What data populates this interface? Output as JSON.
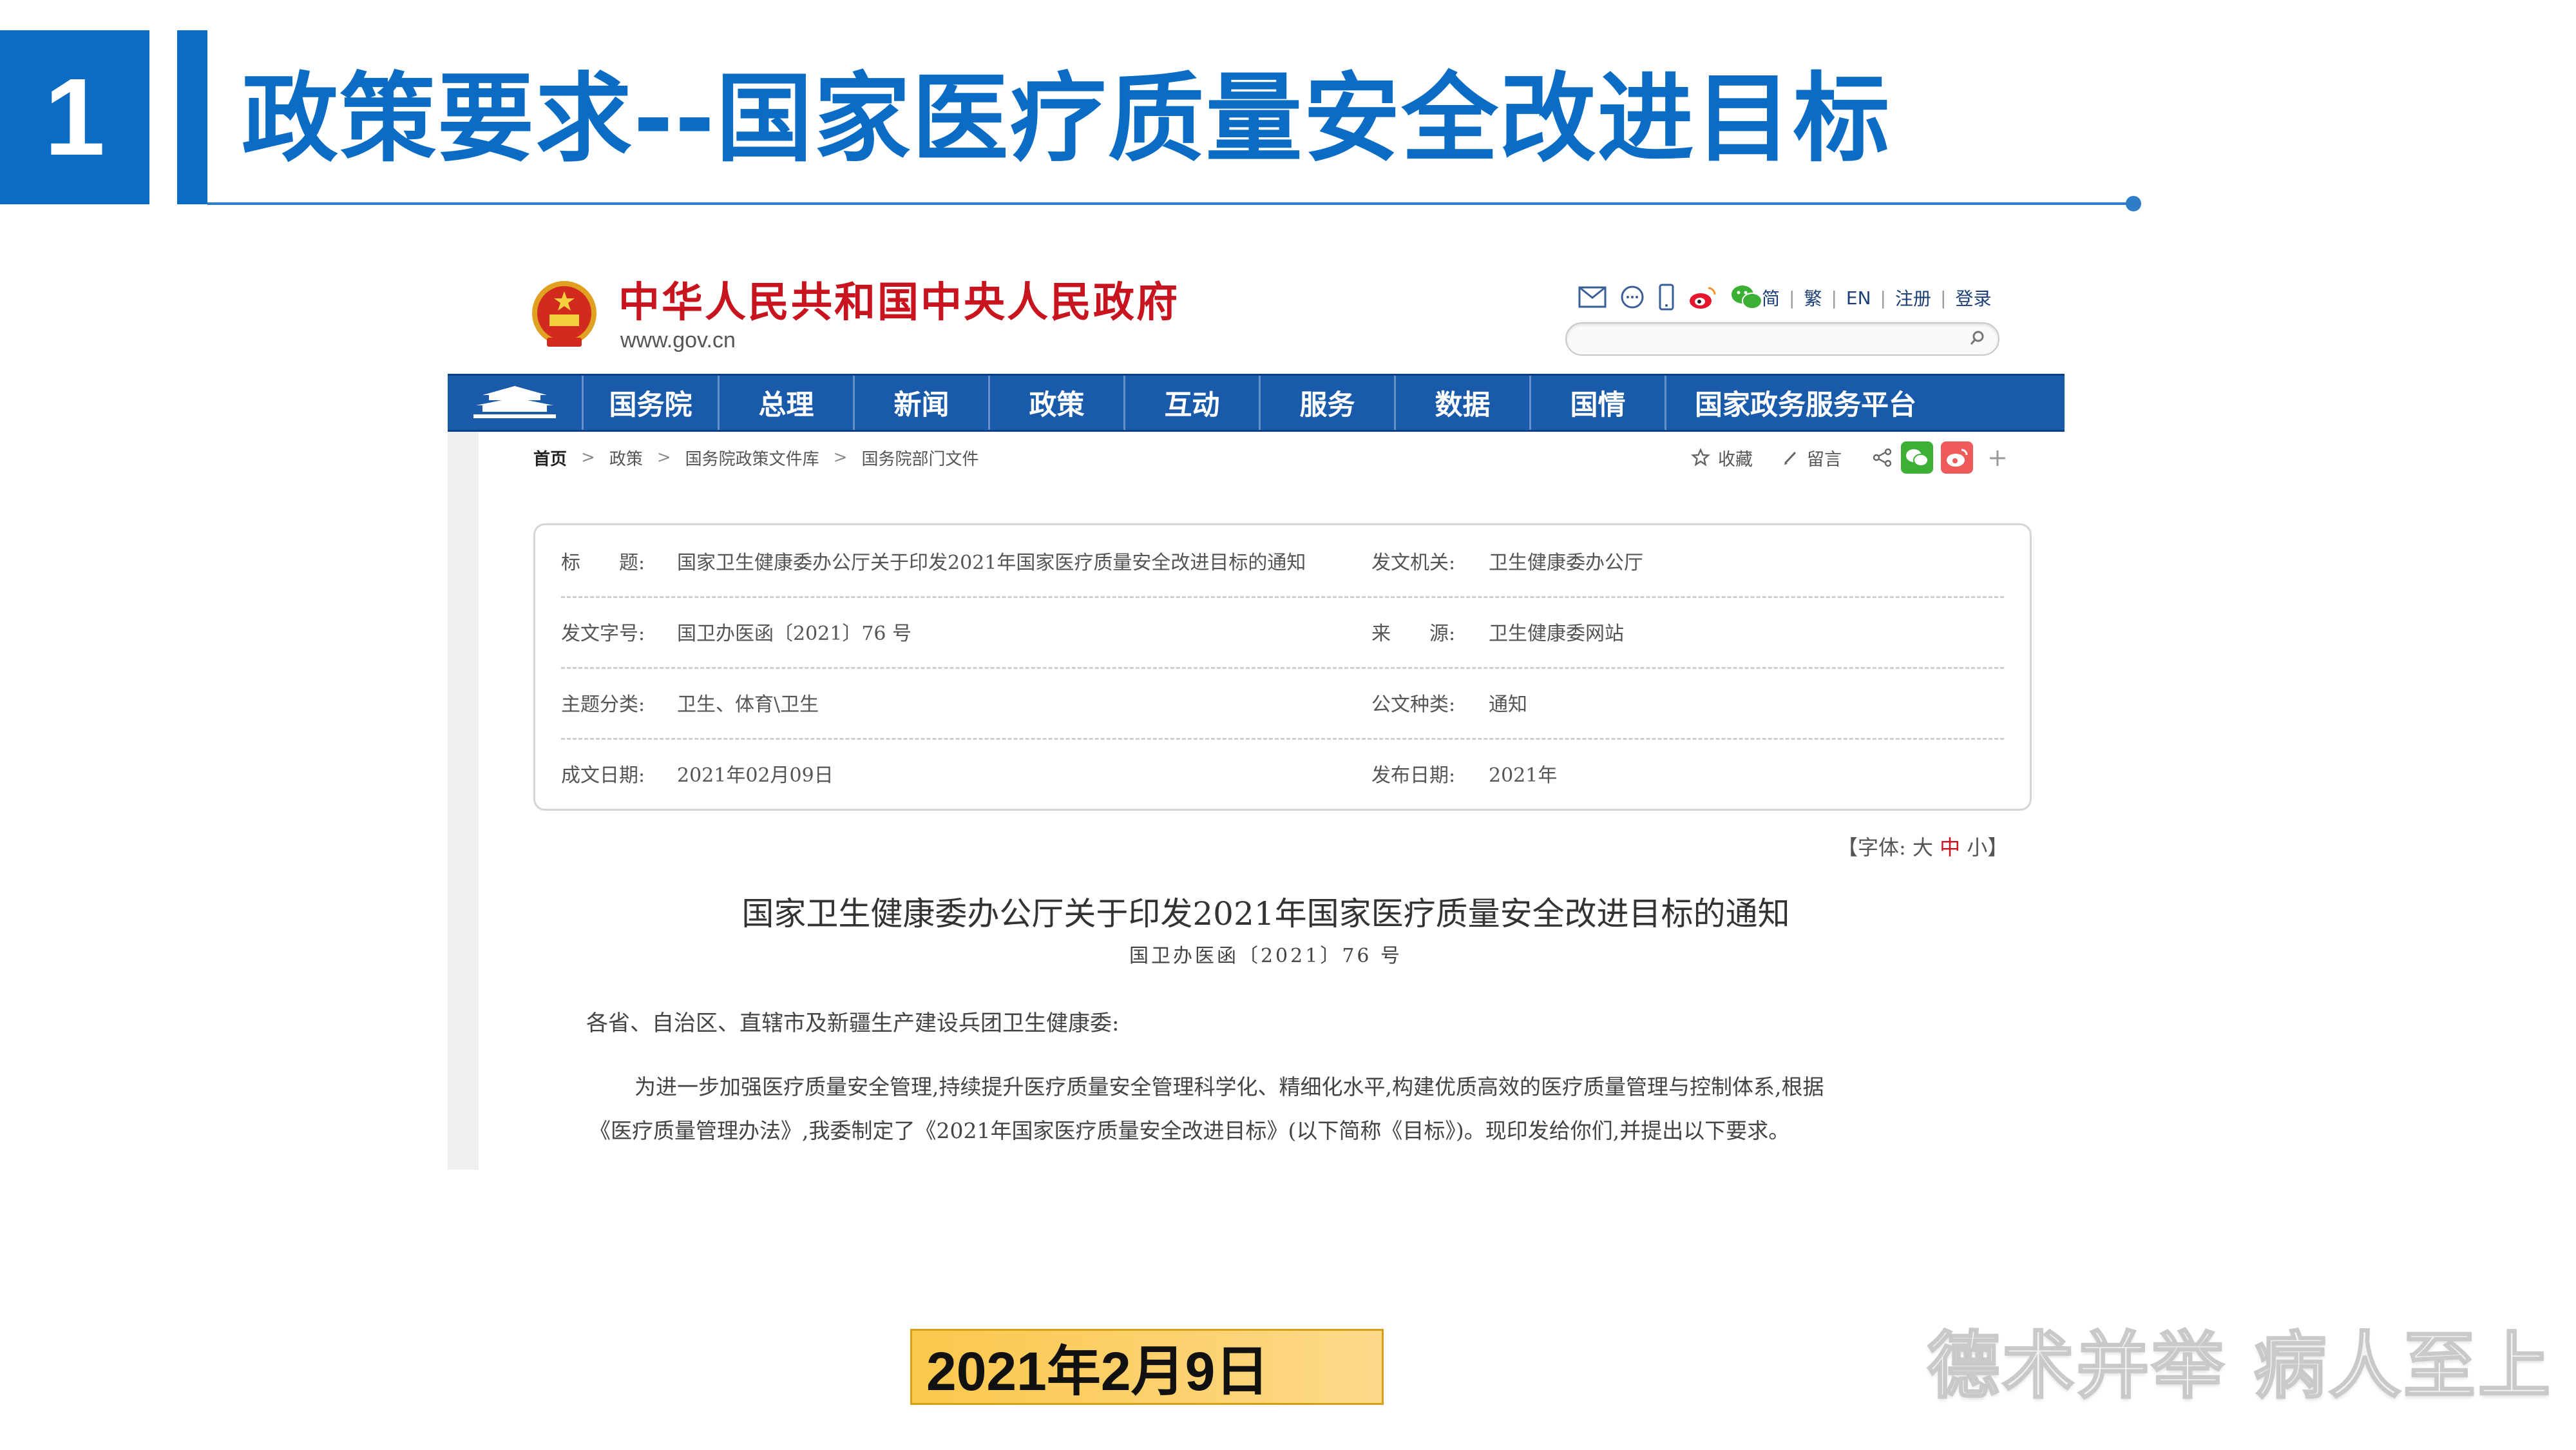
{
  "slide": {
    "number": "1",
    "title": "政策要求--国家医疗质量安全改进目标",
    "date_label": "2021年2月9日",
    "slogan": "德术并举 病人至上"
  },
  "site": {
    "name": "中华人民共和国中央人民政府",
    "url": "www.gov.cn",
    "lang_links": [
      "简",
      "繁",
      "EN",
      "注册",
      "登录"
    ],
    "icons": [
      "mail-icon",
      "chat-icon",
      "mobile-icon",
      "weibo-icon",
      "wechat-icon"
    ],
    "nav": [
      "国务院",
      "总理",
      "新闻",
      "政策",
      "互动",
      "服务",
      "数据",
      "国情",
      "国家政务服务平台"
    ]
  },
  "breadcrumb": [
    "首页",
    "政策",
    "国务院政策文件库",
    "国务院部门文件"
  ],
  "share": {
    "collect": "收藏",
    "comment": "留言",
    "plus": "+"
  },
  "info": {
    "title_label": "标　　题:",
    "title_value": "国家卫生健康委办公厅关于印发2021年国家医疗质量安全改进目标的通知",
    "issuer_label": "发文机关:",
    "issuer_value": "卫生健康委办公厅",
    "docno_label": "发文字号:",
    "docno_value": "国卫办医函〔2021〕76 号",
    "source_label": "来　　源:",
    "source_value": "卫生健康委网站",
    "topic_label": "主题分类:",
    "topic_value": "卫生、体育\\卫生",
    "type_label": "公文种类:",
    "type_value": "通知",
    "written_label": "成文日期:",
    "written_value": "2021年02月09日",
    "publish_label": "发布日期:",
    "publish_value": "2021年"
  },
  "font_size": {
    "prefix": "【字体:",
    "large": "大",
    "medium": "中",
    "small": "小",
    "suffix": "】"
  },
  "document": {
    "title": "国家卫生健康委办公厅关于印发2021年国家医疗质量安全改进目标的通知",
    "number": "国卫办医函〔2021〕76 号",
    "salutation": "各省、自治区、直辖市及新疆生产建设兵团卫生健康委:",
    "para_line1": "为进一步加强医疗质量安全管理,持续提升医疗质量安全管理科学化、精细化水平,构建优质高效的医疗质量管理与控制体系,根据",
    "para_line2": "《医疗质量管理办法》,我委制定了《2021年国家医疗质量安全改进目标》(以下简称《目标》)。现印发给你们,并提出以下要求。"
  },
  "colors": {
    "brand_blue": "#0a6cc4",
    "nav_blue": "#1a5aab",
    "gov_red": "#c8141e",
    "date_fill": "#fbc84c"
  }
}
